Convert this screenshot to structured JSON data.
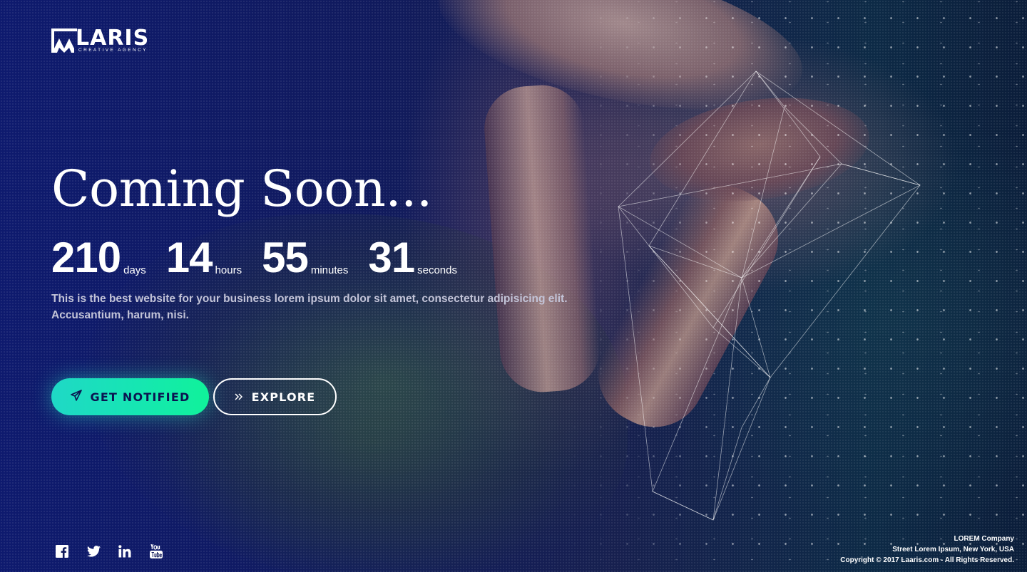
{
  "brand": {
    "name": "LARIS",
    "tagline": "CREATIVE AGENCY"
  },
  "hero": {
    "title": "Coming Soon...",
    "description_line1": "This is the best website for your business lorem ipsum dolor sit amet, consectetur adipisicing elit.",
    "description_line2": "Accusantium, harum, nisi."
  },
  "countdown": [
    {
      "value": "210",
      "label": "days"
    },
    {
      "value": "14",
      "label": "hours"
    },
    {
      "value": "55",
      "label": "minutes"
    },
    {
      "value": "31",
      "label": "seconds"
    }
  ],
  "buttons": {
    "notify_label": "GET NOTIFIED",
    "notify_icon": "paper-plane-icon",
    "explore_label": "EXPLORE",
    "explore_icon": "double-chevron-right-icon"
  },
  "social": [
    "facebook-icon",
    "twitter-icon",
    "linkedin-icon",
    "youtube-icon"
  ],
  "footer": {
    "company": "LOREM Company",
    "address": "Street Lorem Ipsum, New York, USA",
    "copyright": "Copyright © 2017 Laaris.com - All Rights Reserved."
  },
  "colors": {
    "background": "#0e1a6e",
    "accent_gradient_start": "#1fd8c6",
    "accent_gradient_end": "#10f29a",
    "text": "#ffffff",
    "muted_text": "#c3c4d8"
  }
}
